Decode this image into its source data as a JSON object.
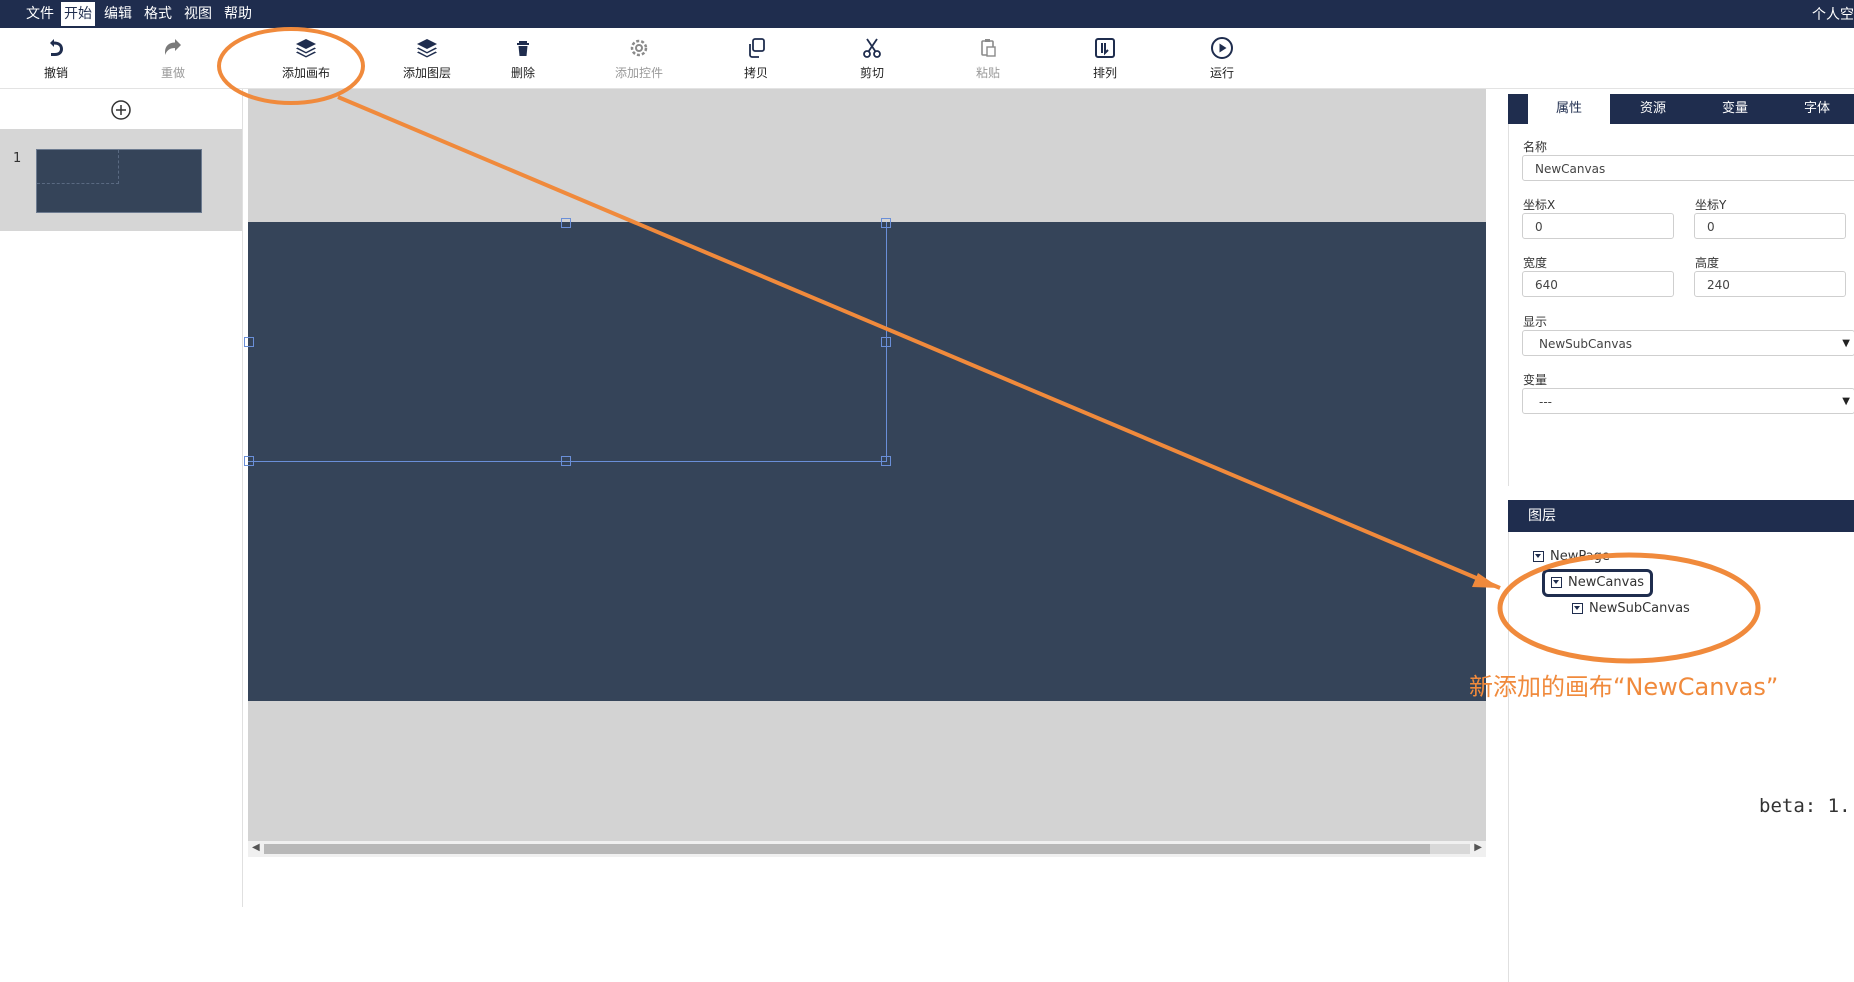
{
  "menubar": {
    "items": [
      "文件",
      "开始",
      "编辑",
      "格式",
      "视图",
      "帮助"
    ],
    "active_index": 1,
    "user_label": "个人空"
  },
  "toolbar": {
    "undo": "撤销",
    "redo": "重做",
    "add_canvas": "添加画布",
    "add_layer": "添加图层",
    "delete": "删除",
    "add_widget": "添加控件",
    "copy": "拷贝",
    "cut": "剪切",
    "paste": "粘贴",
    "arrange": "排列",
    "run": "运行"
  },
  "pages": {
    "items": [
      {
        "number": "1"
      }
    ]
  },
  "properties": {
    "tabs": [
      "属性",
      "资源",
      "变量",
      "字体"
    ],
    "active_tab": 0,
    "name_label": "名称",
    "name_value": "NewCanvas",
    "x_label": "坐标X",
    "x_value": "0",
    "y_label": "坐标Y",
    "y_value": "0",
    "width_label": "宽度",
    "width_value": "640",
    "height_label": "高度",
    "height_value": "240",
    "display_label": "显示",
    "display_value": "NewSubCanvas",
    "variable_label": "变量",
    "variable_value": "---"
  },
  "layers": {
    "title": "图层",
    "root": "NewPage",
    "canvas": "NewCanvas",
    "subcanvas": "NewSubCanvas"
  },
  "version_text": "beta: 1.",
  "annotation_text": "新添加的画布“NewCanvas”",
  "colors": {
    "navy": "#1f2d4e",
    "canvas": "#354459",
    "accent_orange": "#f08a3c",
    "selection": "#6a8fd8"
  }
}
